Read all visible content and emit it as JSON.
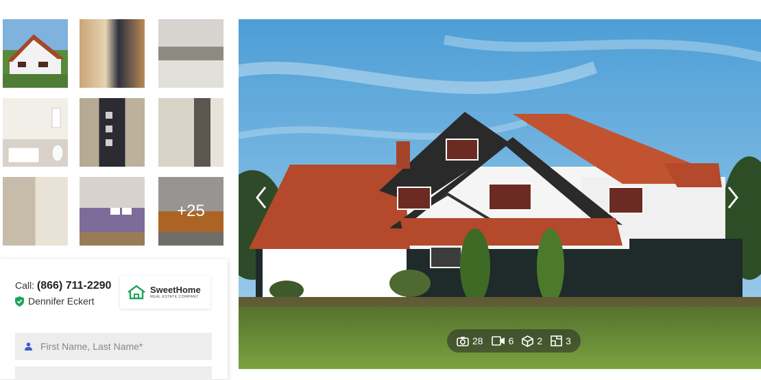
{
  "gallery": {
    "thumbnails": [
      {
        "name": "thumb-exterior"
      },
      {
        "name": "thumb-living-room"
      },
      {
        "name": "thumb-kitchen"
      },
      {
        "name": "thumb-bathroom-1"
      },
      {
        "name": "thumb-door"
      },
      {
        "name": "thumb-bathroom-2"
      },
      {
        "name": "thumb-room"
      },
      {
        "name": "thumb-bedroom-1"
      },
      {
        "name": "thumb-bedroom-2"
      }
    ],
    "more_label": "+25"
  },
  "contact": {
    "call_prefix": "Call:",
    "phone": "(866) 711-2290",
    "agent_name": "Dennifer Eckert",
    "name_placeholder": "First Name, Last Name*"
  },
  "logo": {
    "name": "SweetHome",
    "subtitle": "REAL ESTATE COMPANY"
  },
  "media_counts": {
    "photos": "28",
    "videos": "6",
    "tours_3d": "2",
    "floor_plans": "3"
  },
  "colors": {
    "accent_green": "#1fa35a",
    "field_bg": "#ededed"
  }
}
